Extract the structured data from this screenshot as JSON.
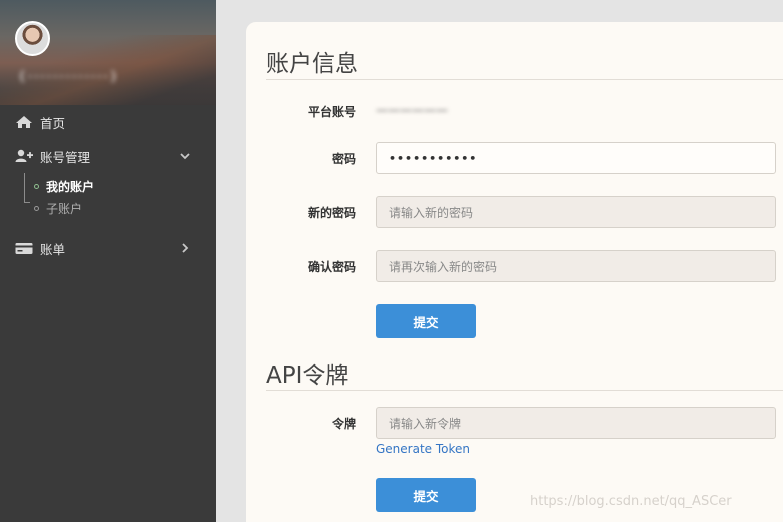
{
  "sidebar": {
    "username": "{-------------}",
    "menu": {
      "home": "首页",
      "account_mgmt": "账号管理",
      "my_account": "我的账户",
      "sub_account": "子账户",
      "billing": "账单"
    }
  },
  "account_section": {
    "title": "账户信息",
    "platform_account_label": "平台账号",
    "platform_account_value": "——————",
    "password_label": "密码",
    "password_value": "•••••••••••",
    "new_password_label": "新的密码",
    "new_password_placeholder": "请输入新的密码",
    "confirm_password_label": "确认密码",
    "confirm_password_placeholder": "请再次输入新的密码",
    "submit_label": "提交"
  },
  "token_section": {
    "title": "API令牌",
    "token_label": "令牌",
    "token_placeholder": "请输入新令牌",
    "generate_label": "Generate Token",
    "submit_label": "提交"
  },
  "watermark": "https://blog.csdn.net/qq_ASCer",
  "colors": {
    "sidebar_bg": "#3a3a3a",
    "panel_bg": "#fdfaf5",
    "button_blue": "#3c8fd8",
    "link_blue": "#3475c4"
  }
}
